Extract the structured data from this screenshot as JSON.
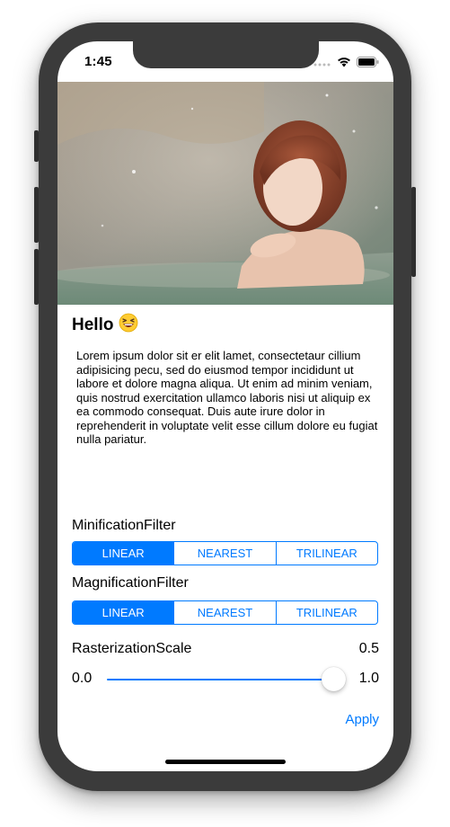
{
  "status_bar": {
    "time": "1:45",
    "icons": [
      "cellular-dots-icon",
      "wifi-icon",
      "battery-icon"
    ]
  },
  "hero_image": {
    "icon": "photo-image"
  },
  "title": {
    "text": "Hello",
    "emoji": "😆"
  },
  "body": {
    "text": "Lorem ipsum dolor sit er elit lamet, consectetaur cillium adipisicing pecu, sed do eiusmod tempor incididunt ut labore et dolore magna aliqua. Ut enim ad minim veniam, quis nostrud exercitation ullamco laboris nisi ut aliquip ex ea commodo consequat. Duis aute irure dolor in reprehenderit in voluptate velit esse cillum dolore eu fugiat nulla pariatur."
  },
  "minification": {
    "label": "MinificationFilter",
    "options": [
      "LINEAR",
      "NEAREST",
      "TRILINEAR"
    ],
    "selected": "LINEAR"
  },
  "magnification": {
    "label": "MagnificationFilter",
    "options": [
      "LINEAR",
      "NEAREST",
      "TRILINEAR"
    ],
    "selected": "LINEAR"
  },
  "rasterization": {
    "label": "RasterizationScale",
    "value": "0.5",
    "slider_min": "0.0",
    "slider_max": "1.0",
    "slider_fraction": 1.0
  },
  "actions": {
    "apply_label": "Apply"
  },
  "colors": {
    "accent": "#007aff",
    "device_frame": "#3b3b3b"
  }
}
